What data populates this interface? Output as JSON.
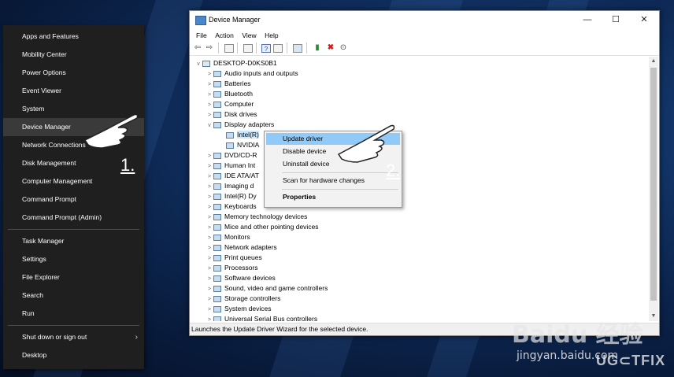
{
  "winx_menu": {
    "items": [
      "Apps and Features",
      "Mobility Center",
      "Power Options",
      "Event Viewer",
      "System",
      "Device Manager",
      "Network Connections",
      "Disk Management",
      "Computer Management",
      "Command Prompt",
      "Command Prompt (Admin)"
    ],
    "items2": [
      "Task Manager",
      "Settings",
      "File Explorer",
      "Search",
      "Run"
    ],
    "items3": [
      "Shut down or sign out",
      "Desktop"
    ],
    "highlighted": "Device Manager"
  },
  "steps": {
    "one": "1.",
    "two": "2."
  },
  "window": {
    "title": "Device Manager",
    "menu": [
      "File",
      "Action",
      "View",
      "Help"
    ]
  },
  "tree": {
    "root": "DESKTOP-D0KS0B1",
    "rows": [
      {
        "label": "Audio inputs and outputs",
        "exp": ">"
      },
      {
        "label": "Batteries",
        "exp": ">"
      },
      {
        "label": "Bluetooth",
        "exp": ">"
      },
      {
        "label": "Computer",
        "exp": ">"
      },
      {
        "label": "Disk drives",
        "exp": ">"
      },
      {
        "label": "Display adapters",
        "exp": "v"
      },
      {
        "label": "Intel(R)",
        "exp": "",
        "child": true,
        "selected": true
      },
      {
        "label": "NVIDIA",
        "exp": "",
        "child": true
      },
      {
        "label": "DVD/CD-R",
        "exp": ">"
      },
      {
        "label": "Human Int",
        "exp": ">"
      },
      {
        "label": "IDE ATA/AT",
        "exp": ">"
      },
      {
        "label": "Imaging d",
        "exp": ">"
      },
      {
        "label": "Intel(R) Dy",
        "exp": ">"
      },
      {
        "label": "Keyboards",
        "exp": ">"
      },
      {
        "label": "Memory technology devices",
        "exp": ">"
      },
      {
        "label": "Mice and other pointing devices",
        "exp": ">"
      },
      {
        "label": "Monitors",
        "exp": ">"
      },
      {
        "label": "Network adapters",
        "exp": ">"
      },
      {
        "label": "Print queues",
        "exp": ">"
      },
      {
        "label": "Processors",
        "exp": ">"
      },
      {
        "label": "Software devices",
        "exp": ">"
      },
      {
        "label": "Sound, video and game controllers",
        "exp": ">"
      },
      {
        "label": "Storage controllers",
        "exp": ">"
      },
      {
        "label": "System devices",
        "exp": ">"
      },
      {
        "label": "Universal Serial Bus controllers",
        "exp": ">"
      }
    ]
  },
  "context_menu": {
    "update": "Update driver",
    "disable": "Disable device",
    "uninstall": "Uninstall device",
    "scan": "Scan for hardware changes",
    "properties": "Properties"
  },
  "status": "Launches the Update Driver Wizard for the selected device.",
  "watermark": {
    "baidu": "Baidu 经验",
    "url": "jingyan.baidu.com",
    "fix": "UG⊂TFIX"
  }
}
